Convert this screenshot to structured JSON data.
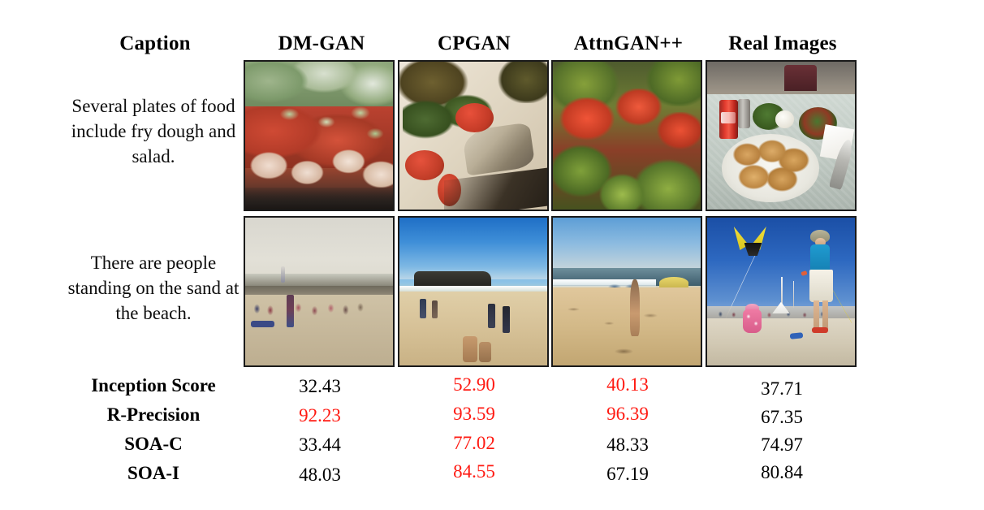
{
  "figure": {
    "accent_red": "#FF1A12",
    "text_black": "#000000",
    "background": "#FFFFFF"
  },
  "columns": {
    "caption_header": "Caption",
    "models": [
      "DM-GAN",
      "CPGAN",
      "AttnGAN++",
      "Real Images"
    ]
  },
  "rows": [
    {
      "caption": "Several plates of food include fry dough and salad.",
      "images": [
        {
          "model": "DM-GAN",
          "alt": "plate of salad with tomato and shrimp"
        },
        {
          "model": "CPGAN",
          "alt": "plate of food with tomato slices and spoon"
        },
        {
          "model": "AttnGAN++",
          "alt": "chunky red and green vegetables"
        },
        {
          "model": "Real Images",
          "alt": "table with fried pastries, salads, rice and a soda can"
        }
      ]
    },
    {
      "caption": "There are people standing on the sand at the beach.",
      "images": [
        {
          "model": "DM-GAN",
          "alt": "hazy beach with small figures on sand"
        },
        {
          "model": "CPGAN",
          "alt": "blue sky beach with dark headland and people"
        },
        {
          "model": "AttnGAN++",
          "alt": "beach with surf and a lone figure on sand"
        },
        {
          "model": "Real Images",
          "alt": "woman and child on beach with a yellow kite"
        }
      ]
    }
  ],
  "chart_data": {
    "type": "table",
    "title": "",
    "categories": [
      "DM-GAN",
      "CPGAN",
      "AttnGAN++",
      "Real Images"
    ],
    "metrics": [
      "Inception Score",
      "R-Precision",
      "SOA-C",
      "SOA-I"
    ],
    "highlight_color": "#FF1A12",
    "rows": [
      {
        "metric": "Inception Score",
        "values": [
          "32.43",
          "52.90",
          "40.13",
          "37.71"
        ],
        "highlight": [
          false,
          true,
          true,
          false
        ]
      },
      {
        "metric": "R-Precision",
        "values": [
          "92.23",
          "93.59",
          "96.39",
          "67.35"
        ],
        "highlight": [
          true,
          true,
          true,
          false
        ]
      },
      {
        "metric": "SOA-C",
        "values": [
          "33.44",
          "77.02",
          "48.33",
          "74.97"
        ],
        "highlight": [
          false,
          true,
          false,
          false
        ]
      },
      {
        "metric": "SOA-I",
        "values": [
          "48.03",
          "84.55",
          "67.19",
          "80.84"
        ],
        "highlight": [
          false,
          true,
          false,
          false
        ]
      }
    ]
  }
}
